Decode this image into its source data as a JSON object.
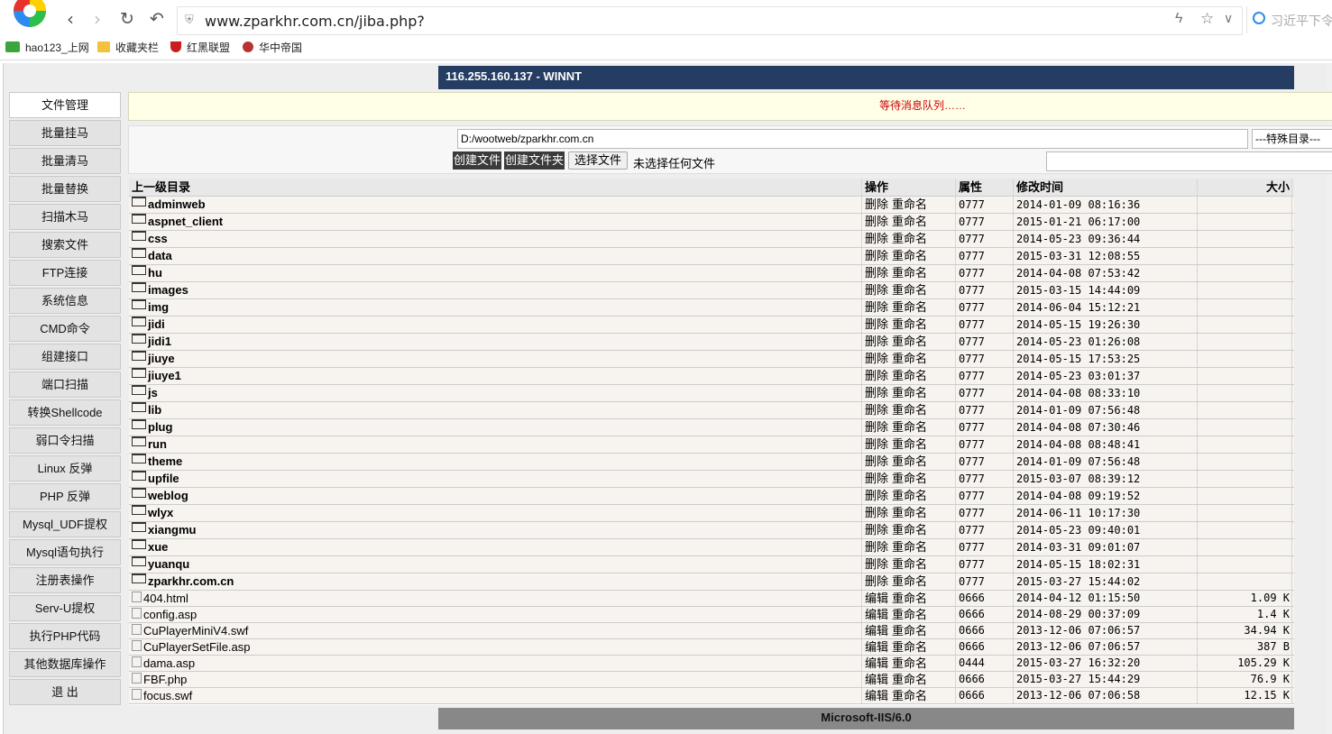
{
  "browser": {
    "url": "www.zparkhr.com.cn/jiba.php?",
    "search_placeholder": "习近平下令",
    "bookmarks": [
      "hao123_上网",
      "收藏夹栏",
      "红黑联盟",
      "华中帝国"
    ]
  },
  "header": {
    "title": "116.255.160.137 - WINNT"
  },
  "sidebar": [
    {
      "label": "文件管理",
      "active": true
    },
    {
      "label": "批量挂马"
    },
    {
      "label": "批量清马"
    },
    {
      "label": "批量替换"
    },
    {
      "label": "扫描木马"
    },
    {
      "label": "搜索文件"
    },
    {
      "label": "FTP连接"
    },
    {
      "label": "系统信息"
    },
    {
      "label": "CMD命令"
    },
    {
      "label": "组建接口"
    },
    {
      "label": "端口扫描"
    },
    {
      "label": "转换Shellcode"
    },
    {
      "label": "弱口令扫描"
    },
    {
      "label": "Linux 反弹"
    },
    {
      "label": "PHP 反弹"
    },
    {
      "label": "Mysql_UDF提权"
    },
    {
      "label": "Mysql语句执行"
    },
    {
      "label": "注册表操作"
    },
    {
      "label": "Serv-U提权"
    },
    {
      "label": "执行PHP代码"
    },
    {
      "label": "其他数据库操作"
    },
    {
      "label": "退 出"
    }
  ],
  "message": "等待消息队列……",
  "toolbox": {
    "path": "D:/wootweb/zparkhr.com.cn",
    "special_dir": "---特殊目录---",
    "create_file": "创建文件",
    "create_folder": "创建文件夹",
    "choose_file": "选择文件",
    "no_file": "未选择任何文件"
  },
  "listing": {
    "headers": {
      "name": "上一级目录",
      "ops": "操作",
      "perm": "属性",
      "time": "修改时间",
      "size": "大小"
    },
    "dir_ops": [
      "删除",
      "重命名"
    ],
    "file_ops": [
      "编辑",
      "重命名"
    ],
    "dirs": [
      {
        "name": "adminweb",
        "perm": "0777",
        "time": "2014-01-09 08:16:36"
      },
      {
        "name": "aspnet_client",
        "perm": "0777",
        "time": "2015-01-21 06:17:00"
      },
      {
        "name": "css",
        "perm": "0777",
        "time": "2014-05-23 09:36:44"
      },
      {
        "name": "data",
        "perm": "0777",
        "time": "2015-03-31 12:08:55"
      },
      {
        "name": "hu",
        "perm": "0777",
        "time": "2014-04-08 07:53:42"
      },
      {
        "name": "images",
        "perm": "0777",
        "time": "2015-03-15 14:44:09"
      },
      {
        "name": "img",
        "perm": "0777",
        "time": "2014-06-04 15:12:21"
      },
      {
        "name": "jidi",
        "perm": "0777",
        "time": "2014-05-15 19:26:30"
      },
      {
        "name": "jidi1",
        "perm": "0777",
        "time": "2014-05-23 01:26:08"
      },
      {
        "name": "jiuye",
        "perm": "0777",
        "time": "2014-05-15 17:53:25"
      },
      {
        "name": "jiuye1",
        "perm": "0777",
        "time": "2014-05-23 03:01:37"
      },
      {
        "name": "js",
        "perm": "0777",
        "time": "2014-04-08 08:33:10"
      },
      {
        "name": "lib",
        "perm": "0777",
        "time": "2014-01-09 07:56:48"
      },
      {
        "name": "plug",
        "perm": "0777",
        "time": "2014-04-08 07:30:46"
      },
      {
        "name": "run",
        "perm": "0777",
        "time": "2014-04-08 08:48:41"
      },
      {
        "name": "theme",
        "perm": "0777",
        "time": "2014-01-09 07:56:48"
      },
      {
        "name": "upfile",
        "perm": "0777",
        "time": "2015-03-07 08:39:12"
      },
      {
        "name": "weblog",
        "perm": "0777",
        "time": "2014-04-08 09:19:52"
      },
      {
        "name": "wlyx",
        "perm": "0777",
        "time": "2014-06-11 10:17:30"
      },
      {
        "name": "xiangmu",
        "perm": "0777",
        "time": "2014-05-23 09:40:01"
      },
      {
        "name": "xue",
        "perm": "0777",
        "time": "2014-03-31 09:01:07"
      },
      {
        "name": "yuanqu",
        "perm": "0777",
        "time": "2014-05-15 18:02:31"
      },
      {
        "name": "zparkhr.com.cn",
        "perm": "0777",
        "time": "2015-03-27 15:44:02"
      }
    ],
    "files": [
      {
        "name": "404.html",
        "perm": "0666",
        "time": "2014-04-12 01:15:50",
        "size": "1.09 K"
      },
      {
        "name": "config.asp",
        "perm": "0666",
        "time": "2014-08-29 00:37:09",
        "size": "1.4 K"
      },
      {
        "name": "CuPlayerMiniV4.swf",
        "perm": "0666",
        "time": "2013-12-06 07:06:57",
        "size": "34.94 K"
      },
      {
        "name": "CuPlayerSetFile.asp",
        "perm": "0666",
        "time": "2013-12-06 07:06:57",
        "size": "387 B"
      },
      {
        "name": "dama.asp",
        "perm": "0444",
        "time": "2015-03-27 16:32:20",
        "size": "105.29 K"
      },
      {
        "name": "FBF.php",
        "perm": "0666",
        "time": "2015-03-27 15:44:29",
        "size": "76.9 K"
      },
      {
        "name": "focus.swf",
        "perm": "0666",
        "time": "2013-12-06 07:06:58",
        "size": "12.15 K"
      }
    ]
  },
  "footer": "Microsoft-IIS/6.0"
}
